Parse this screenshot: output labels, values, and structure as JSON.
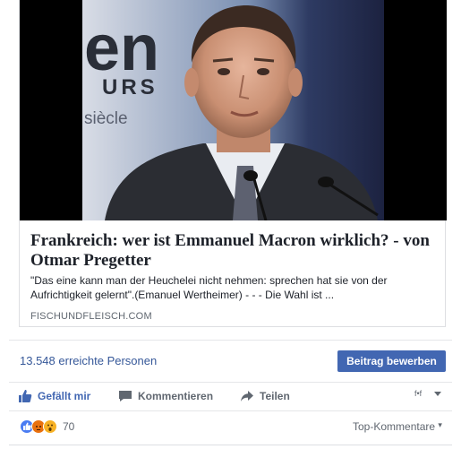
{
  "card": {
    "photo_backdrop_text": "en",
    "photo_backdrop_text2": "URS",
    "photo_backdrop_text3": "siècle",
    "title": "Frankreich: wer ist Emmanuel Macron wirklich? - von Otmar Pregetter",
    "description": "\"Das eine kann man der Heuchelei nicht nehmen: sprechen hat sie von der Aufrichtigkeit gelernt\".(Emanuel Wertheimer) - - - Die Wahl ist ...",
    "domain": "FISCHUNDFLEISCH.COM"
  },
  "stats": {
    "reach_count": "13.548",
    "reach_label": "erreichte Personen",
    "boost_label": "Beitrag bewerben"
  },
  "actions": {
    "like_label": "Gefällt mir",
    "comment_label": "Kommentieren",
    "share_label": "Teilen"
  },
  "reactions": {
    "count": "70",
    "sort_label": "Top-Kommentare"
  },
  "colors": {
    "accent": "#4267b2",
    "link": "#365899",
    "muted": "#606770"
  }
}
